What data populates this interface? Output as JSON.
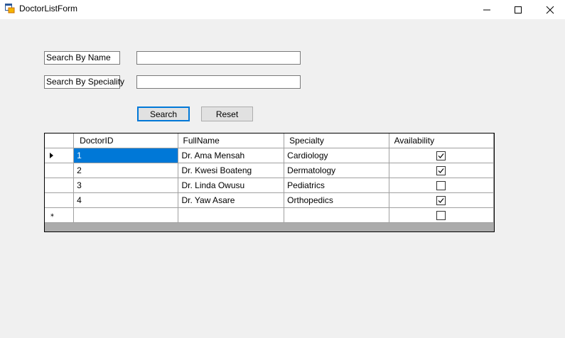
{
  "window": {
    "title": "DoctorListForm"
  },
  "search": {
    "name_label": "Search By Name",
    "name_value": "",
    "specialty_label": "Search By Speciality",
    "specialty_value": "",
    "search_button": "Search",
    "reset_button": "Reset"
  },
  "grid": {
    "columns": [
      "DoctorID",
      "FullName",
      "Specialty",
      "Availability"
    ],
    "rows": [
      {
        "id": "1",
        "name": "Dr. Ama Mensah",
        "specialty": "Cardiology",
        "available": true
      },
      {
        "id": "2",
        "name": "Dr. Kwesi Boateng",
        "specialty": "Dermatology",
        "available": true
      },
      {
        "id": "3",
        "name": "Dr. Linda Owusu",
        "specialty": "Pediatrics",
        "available": false
      },
      {
        "id": "4",
        "name": "Dr. Yaw Asare",
        "specialty": "Orthopedics",
        "available": true
      }
    ],
    "selected_row": 0
  },
  "colors": {
    "selection": "#0078d7",
    "background": "#f0f0f0"
  }
}
